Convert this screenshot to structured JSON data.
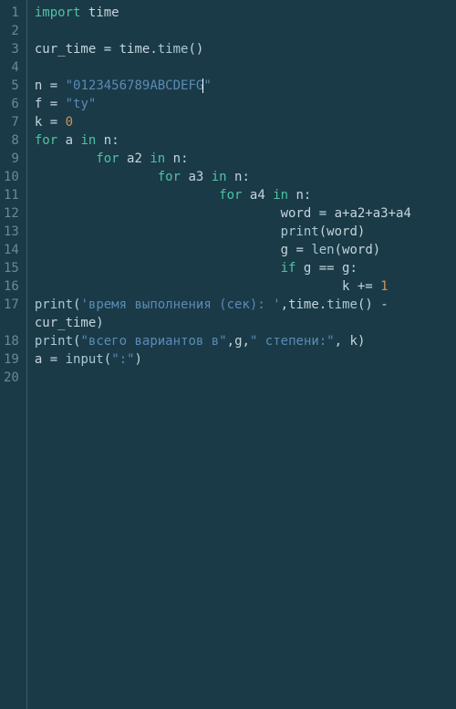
{
  "gutter": [
    "1",
    "2",
    "3",
    "4",
    "5",
    "6",
    "7",
    "8",
    "9",
    "10",
    "11",
    "12",
    "13",
    "14",
    "15",
    "16",
    "17",
    "",
    "18",
    "19",
    "20"
  ],
  "code": {
    "l1": {
      "kw": "import",
      "sp": " ",
      "id": "time"
    },
    "l3": {
      "id1": "cur_time",
      "op": " = ",
      "id2": "time",
      "dot": ".",
      "fn": "time",
      "par": "()"
    },
    "l5": {
      "id": "n",
      "op": " = ",
      "q1": "\"",
      "str": "0123456789ABCDEFG",
      "q2": "\""
    },
    "l6": {
      "id": "f",
      "op": " = ",
      "q1": "\"",
      "str": "ty",
      "q2": "\""
    },
    "l7": {
      "id": "k",
      "op": " = ",
      "num": "0"
    },
    "l8": {
      "kw1": "for",
      "sp1": " ",
      "id1": "a",
      "sp2": " ",
      "kw2": "in",
      "sp3": " ",
      "id2": "n",
      "col": ":"
    },
    "l9": {
      "indent": "        ",
      "kw1": "for",
      "sp1": " ",
      "id1": "a2",
      "sp2": " ",
      "kw2": "in",
      "sp3": " ",
      "id2": "n",
      "col": ":"
    },
    "l10": {
      "indent": "                ",
      "kw1": "for",
      "sp1": " ",
      "id1": "a3",
      "sp2": " ",
      "kw2": "in",
      "sp3": " ",
      "id2": "n",
      "col": ":"
    },
    "l11": {
      "indent": "                        ",
      "kw1": "for",
      "sp1": " ",
      "id1": "a4",
      "sp2": " ",
      "kw2": "in",
      "sp3": " ",
      "id2": "n",
      "col": ":"
    },
    "l12": {
      "indent": "                                ",
      "id": "word",
      "op": " = ",
      "expr": "a+a2+a3+a4"
    },
    "l13": {
      "indent": "                                ",
      "fn": "print",
      "par": "(word)"
    },
    "l14": {
      "indent": "                                ",
      "id": "g",
      "op": " = ",
      "fn": "len",
      "par": "(word)"
    },
    "l15": {
      "indent": "                                ",
      "kw": "if",
      "sp": " ",
      "expr": "g == g",
      "col": ":"
    },
    "l16": {
      "indent": "                                        ",
      "id": "k",
      "op": " += ",
      "num": "1"
    },
    "l17a": {
      "fn": "print",
      "par1": "(",
      "q1": "'",
      "str": "время выполнения (сек): ",
      "q2": "'",
      "com": ",",
      "id": "time",
      "dot": ".",
      "fn2": "time",
      "par2": "()",
      "op": " - "
    },
    "l17b": {
      "id": "cur_time",
      "par": ")"
    },
    "l18": {
      "fn": "print",
      "par1": "(",
      "q1": "\"",
      "str1": "всего вариантов в",
      "q2": "\"",
      "com1": ",",
      "id1": "g",
      "com2": ",",
      "q3": "\"",
      "str2": " степени:",
      "q4": "\"",
      "com3": ", ",
      "id2": "k",
      "par2": ")"
    },
    "l19": {
      "id": "a",
      "op": " = ",
      "fn": "input",
      "par1": "(",
      "q1": "\"",
      "str": ":",
      "q2": "\"",
      "par2": ")"
    }
  }
}
